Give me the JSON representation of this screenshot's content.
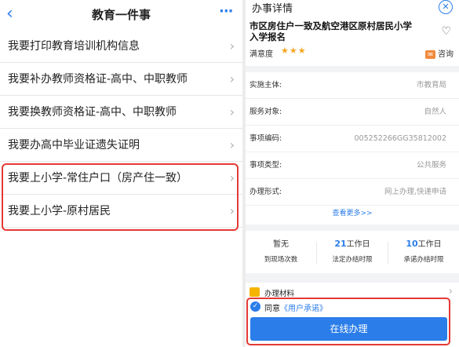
{
  "left": {
    "title": "教育一件事",
    "back_icon": "chevron-left-icon",
    "more_icon": "more-dots-icon",
    "items": [
      {
        "label": "我要打印教育培训机构信息"
      },
      {
        "label": "我要补办教师资格证-高中、中职教师"
      },
      {
        "label": "我要换教师资格证-高中、中职教师"
      },
      {
        "label": "我要办高中毕业证遗失证明"
      },
      {
        "label": "我要上小学-常住户口（房产住一致）"
      },
      {
        "label": "我要上小学-原村居民"
      }
    ],
    "highlight_color": "#e53935"
  },
  "right": {
    "title": "办事详情",
    "service_title": "市区房住户一致及航空港区原村居民小学入学报名",
    "rating_label": "满意度",
    "stars": "★★★",
    "consult_label": "咨询",
    "info": [
      {
        "label": "实施主体:",
        "value": "市教育局"
      },
      {
        "label": "服务对象:",
        "value": "自然人"
      },
      {
        "label": "事项编码:",
        "value": "005252266GG35812002"
      },
      {
        "label": "事项类型:",
        "value": "公共服务"
      },
      {
        "label": "办理形式:",
        "value": "网上办理,快递申请"
      }
    ],
    "more_link": "查看更多>>",
    "stats": [
      {
        "num": "",
        "num_plain": "暂无",
        "unit": "",
        "caption": "到现场次数"
      },
      {
        "num": "21",
        "num_plain": "",
        "unit": "工作日",
        "caption": "法定办结时限"
      },
      {
        "num": "10",
        "num_plain": "",
        "unit": "工作日",
        "caption": "承诺办结时限"
      }
    ],
    "materials_label": "办理材料",
    "agree_prefix": "同意",
    "agree_link": "《用户承诺》",
    "submit_label": "在线办理",
    "accent_color": "#2b7de9"
  }
}
